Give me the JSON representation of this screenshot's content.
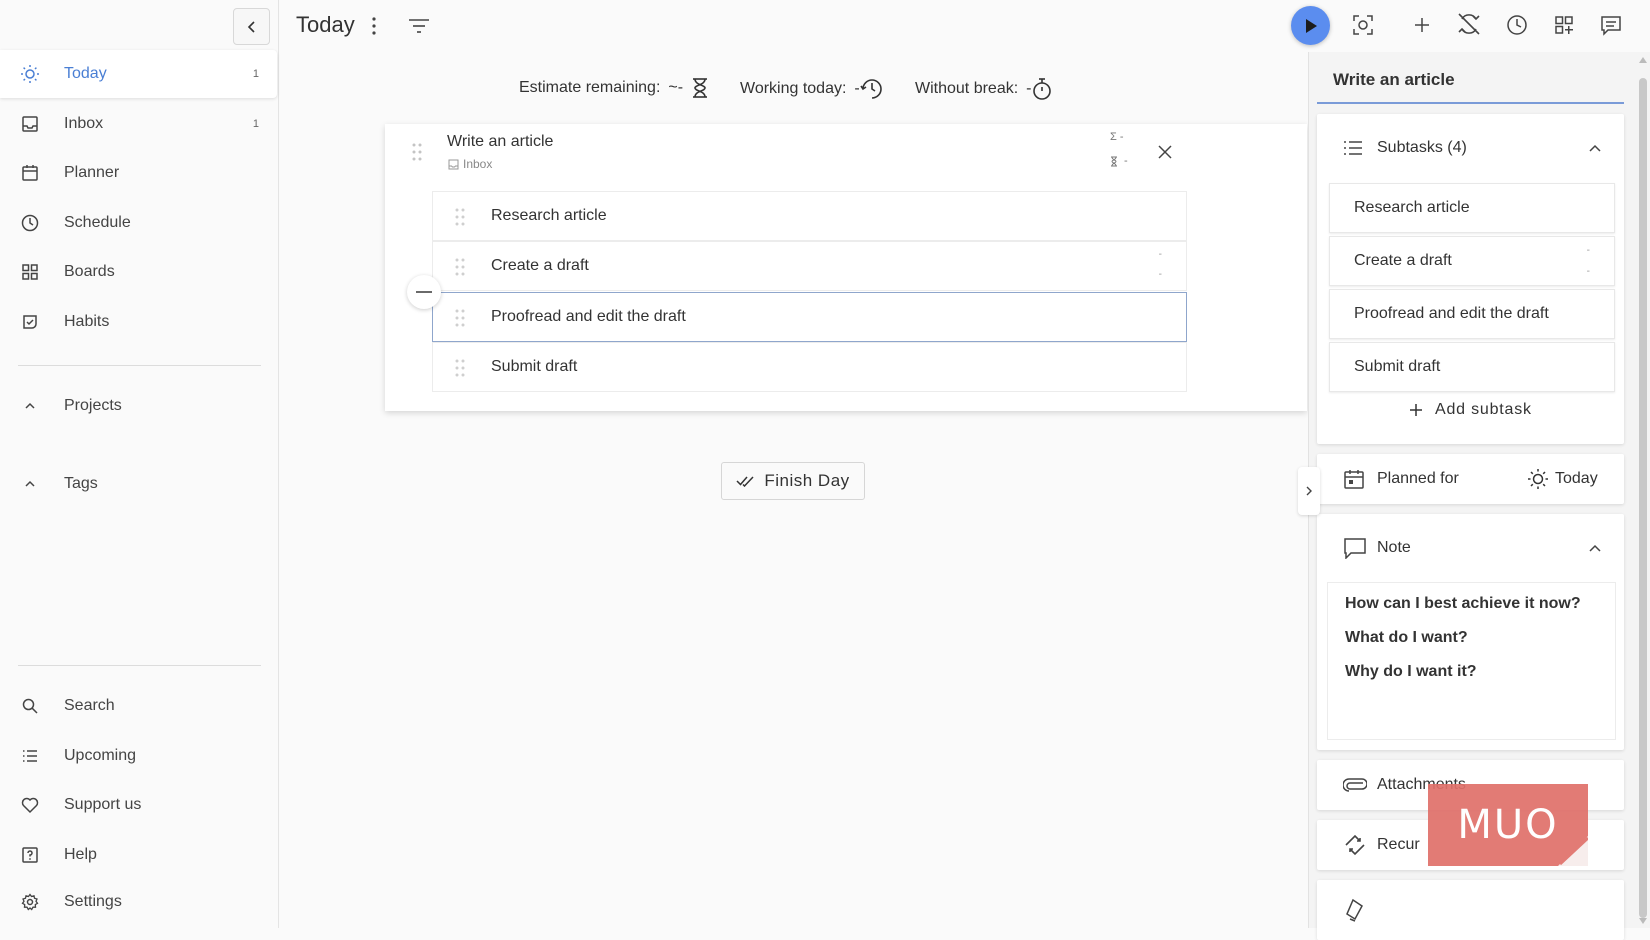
{
  "sidebar": {
    "items": [
      {
        "label": "Today",
        "count": "1",
        "icon": "sun-icon"
      },
      {
        "label": "Inbox",
        "count": "1",
        "icon": "inbox-icon"
      },
      {
        "label": "Planner",
        "icon": "calendar-icon"
      },
      {
        "label": "Schedule",
        "icon": "clock-icon"
      },
      {
        "label": "Boards",
        "icon": "grid-icon"
      },
      {
        "label": "Habits",
        "icon": "habit-icon"
      }
    ],
    "projects_label": "Projects",
    "tags_label": "Tags",
    "bottom_items": [
      {
        "label": "Search",
        "icon": "search-icon"
      },
      {
        "label": "Upcoming",
        "icon": "list-icon"
      },
      {
        "label": "Support us",
        "icon": "heart-icon"
      },
      {
        "label": "Help",
        "icon": "help-icon"
      },
      {
        "label": "Settings",
        "icon": "gear-icon"
      }
    ]
  },
  "header": {
    "title": "Today"
  },
  "metrics": {
    "estimate_label": "Estimate remaining:",
    "estimate_value": "~-",
    "working_label": "Working today:",
    "working_value": "-",
    "break_label": "Without break:",
    "break_value": "-"
  },
  "task": {
    "title": "Write an article",
    "project": "Inbox",
    "time_spent": "Σ -",
    "time_estimate": "-",
    "subtasks": [
      {
        "title": "Research article"
      },
      {
        "title": "Create a draft",
        "time_a": "-",
        "time_b": "-"
      },
      {
        "title": "Proofread and edit the draft"
      },
      {
        "title": "Submit draft"
      }
    ]
  },
  "finish_day_label": "Finish Day",
  "panel": {
    "title": "Write an article",
    "subtasks_header": "Subtasks (4)",
    "subtasks": [
      "Research article",
      "Create a draft",
      "Proofread and edit the draft",
      "Submit draft"
    ],
    "create_draft_time_a": "-",
    "create_draft_time_b": "-",
    "add_subtask_label": "Add subtask",
    "planned_label": "Planned for",
    "planned_value": "Today",
    "note_label": "Note",
    "note_lines": [
      "How can I best achieve it now?",
      "What do I want?",
      "Why do I want it?"
    ],
    "attachments_label": "Attachments",
    "recur_label": "Recur"
  },
  "watermark": "MUO",
  "colors": {
    "accent": "#4a7fd4",
    "play_button": "#5b8def",
    "watermark": "#e0706a"
  }
}
